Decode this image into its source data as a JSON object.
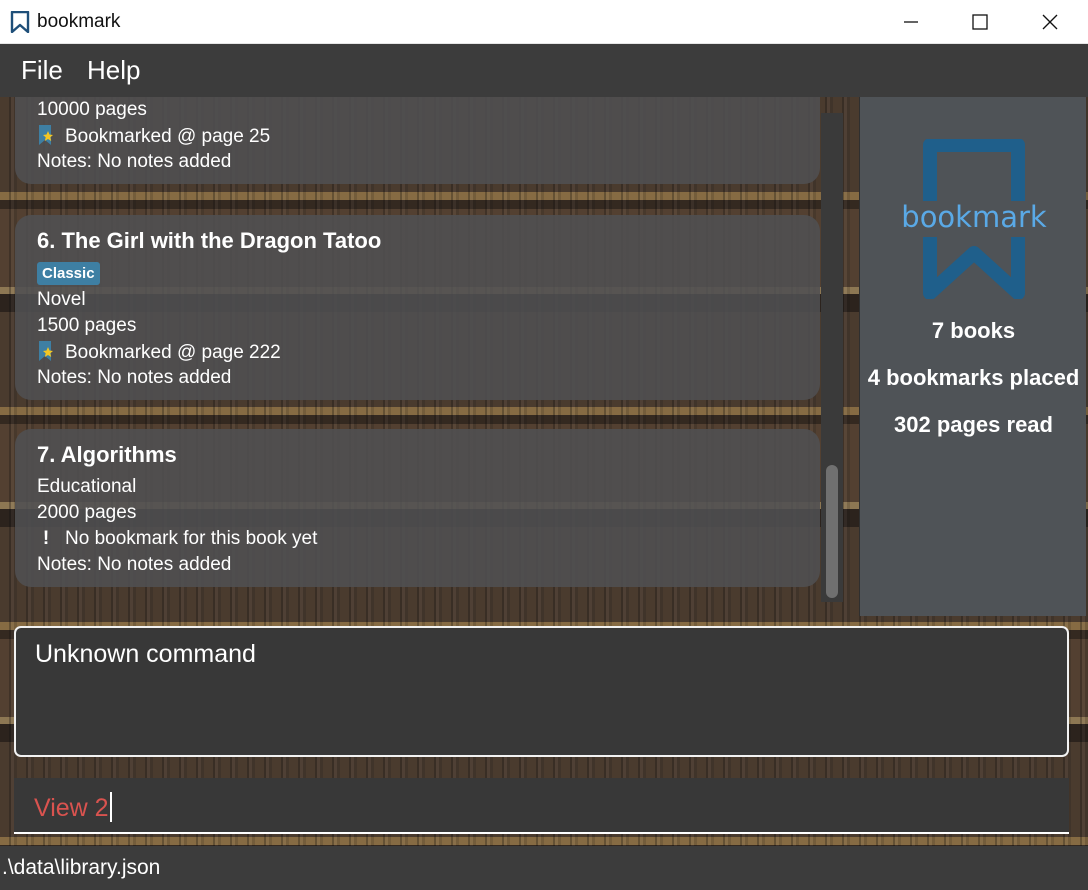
{
  "window": {
    "title": "bookmark",
    "app_icon": "bookmark-outline-icon",
    "controls": [
      "minimize-icon",
      "maximize-icon",
      "close-icon"
    ]
  },
  "menu": {
    "file": "File",
    "help": "Help"
  },
  "books": [
    {
      "pages": "10000 pages",
      "bookmark": "Bookmarked @ page 25",
      "notes": "Notes: No notes added"
    },
    {
      "title": "6.  The Girl with the Dragon Tatoo",
      "tag": "Classic",
      "genre": "Novel",
      "pages": "1500 pages",
      "bookmark": "Bookmarked @ page 222",
      "notes": "Notes: No notes added"
    },
    {
      "title": "7.  Algorithms",
      "genre": "Educational",
      "pages": "2000 pages",
      "bookmark": "No bookmark for this book yet",
      "notes": "Notes: No notes added"
    }
  ],
  "stats": {
    "logo_text": "bookmark",
    "books": "7 books",
    "bookmarks": "4 bookmarks placed",
    "pages_read": "302 pages read"
  },
  "result": {
    "text": "Unknown command"
  },
  "command": {
    "value": "View 2"
  },
  "status": {
    "path": ".\\data\\library.json"
  },
  "colors": {
    "accent_blue": "#3e7fa3",
    "logo_blue": "#1f5f8b",
    "logo_text": "#5aa9e6",
    "error_text": "#d9534f"
  }
}
